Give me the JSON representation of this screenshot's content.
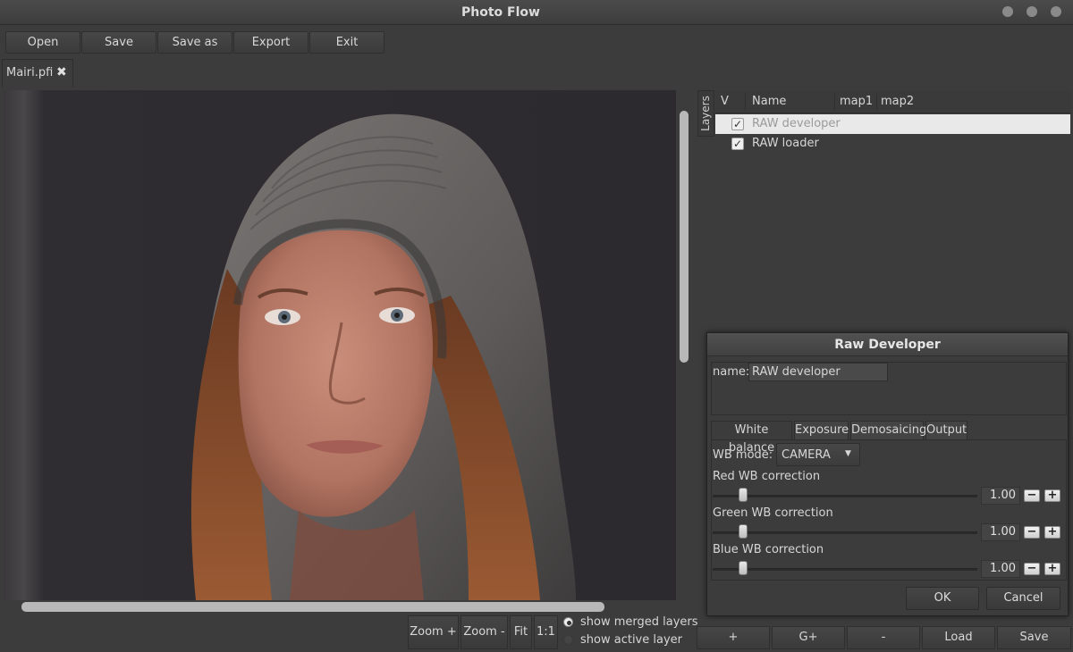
{
  "window": {
    "title": "Photo Flow"
  },
  "toolbar": {
    "open": "Open",
    "save": "Save",
    "save_as": "Save as",
    "export": "Export",
    "exit": "Exit"
  },
  "document_tab": {
    "label": "Mairi.pfi",
    "close_glyph": "✖"
  },
  "viewer": {
    "zoom_in": "Zoom +",
    "zoom_out": "Zoom -",
    "fit": "Fit",
    "one_to_one": "1:1",
    "show_merged": "show merged layers",
    "show_active": "show active layer",
    "selected_view": "show merged layers"
  },
  "layers_panel": {
    "tab_label": "Layers",
    "columns": [
      "V",
      "Name",
      "map1",
      "map2"
    ],
    "rows": [
      {
        "visible": true,
        "name": "RAW developer",
        "selected": true
      },
      {
        "visible": true,
        "name": "RAW loader",
        "selected": false
      }
    ],
    "buttons": {
      "add": "+",
      "group": "G+",
      "remove": "-",
      "load": "Load",
      "save": "Save"
    }
  },
  "dialog": {
    "title": "Raw Developer",
    "name_label": "name:",
    "name_value": "RAW developer",
    "tabs": [
      "White balance",
      "Exposure",
      "Demosaicing",
      "Output"
    ],
    "active_tab": "White balance",
    "wb_mode_label": "WB mode:",
    "wb_mode_value": "CAMERA",
    "sliders": [
      {
        "label": "Red WB correction",
        "value": "1.00"
      },
      {
        "label": "Green WB correction",
        "value": "1.00"
      },
      {
        "label": "Blue WB correction",
        "value": "1.00"
      }
    ],
    "ok": "OK",
    "cancel": "Cancel"
  },
  "colors": {
    "background": "#3c3c3c",
    "selected_row": "#e9e9e9",
    "text": "#d6d6d6"
  }
}
